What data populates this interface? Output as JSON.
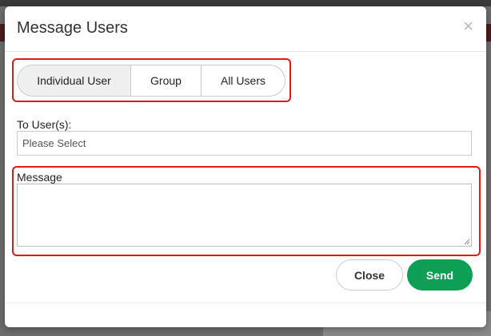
{
  "modal": {
    "title": "Message Users",
    "close_icon": "close-icon"
  },
  "tabs": [
    {
      "label": "Individual User",
      "active": true
    },
    {
      "label": "Group",
      "active": false
    },
    {
      "label": "All Users",
      "active": false
    }
  ],
  "to_field": {
    "label": "To User(s):",
    "placeholder": "Please Select"
  },
  "message_field": {
    "label": "Message",
    "value": ""
  },
  "buttons": {
    "close_label": "Close",
    "send_label": "Send"
  },
  "colors": {
    "send_button": "#0e9e55",
    "highlight_outline": "#e0191a",
    "active_tab_bg": "#efefef"
  }
}
